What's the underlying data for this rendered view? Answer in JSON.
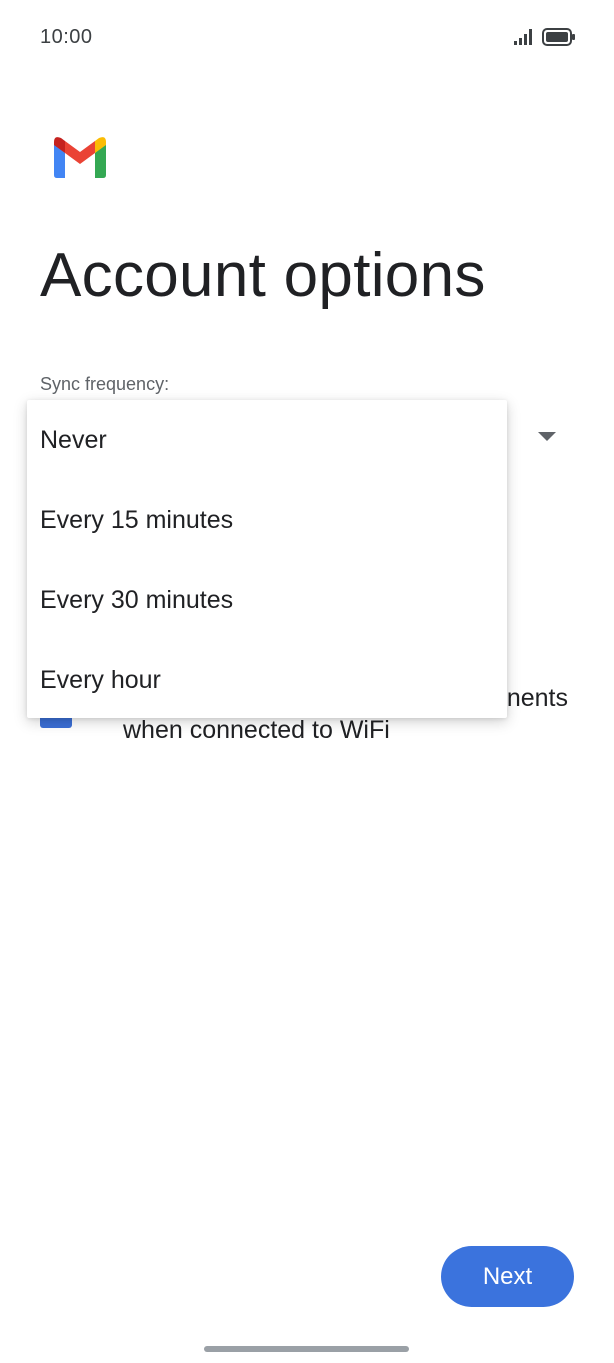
{
  "status_bar": {
    "time": "10:00"
  },
  "header": {
    "logo_icon": "gmail-logo",
    "title": "Account options"
  },
  "sync": {
    "label": "Sync frequency:",
    "options": [
      "Never",
      "Every 15 minutes",
      "Every 30 minutes",
      "Every hour"
    ]
  },
  "download_option": {
    "checked": true,
    "label_line1_visible": "nents",
    "label_line2": "when connected to WiFi"
  },
  "actions": {
    "next_label": "Next"
  },
  "colors": {
    "accent": "#3b73dd",
    "checkbox": "#3b6fd6",
    "text": "#202124",
    "secondary_text": "#5f6368"
  }
}
